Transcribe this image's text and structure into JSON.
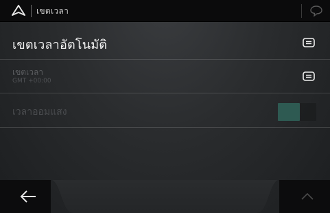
{
  "topbar": {
    "title": "เขตเวลา",
    "nav_icon": "navigation-arrow-icon",
    "chat_icon": "speech-bubble-icon"
  },
  "settings": [
    {
      "label": "เขตเวลาอัตโนมัติ",
      "sublabel": "",
      "control": "menu-icon",
      "enabled": true
    },
    {
      "label": "เขตเวลา",
      "sublabel": "GMT +00:00",
      "control": "menu-icon",
      "enabled": false
    },
    {
      "label": "เวลาออมแสง",
      "sublabel": "",
      "control": "toggle",
      "enabled": false
    }
  ],
  "bottom": {
    "back_icon": "back-arrow-icon",
    "up_icon": "chevron-up-icon"
  },
  "colors": {
    "topbar_bg": "#0b0b0c",
    "toggle_accent": "#2e5a52",
    "disabled_text": "#4a4c4f"
  }
}
